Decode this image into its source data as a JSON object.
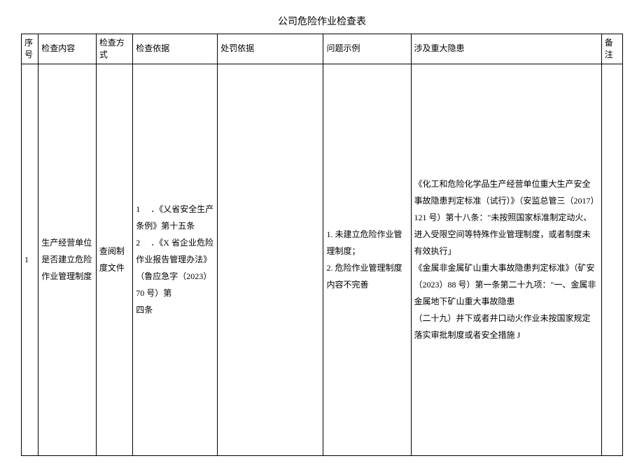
{
  "title": "公司危险作业检查表",
  "headers": {
    "seq": "序号",
    "content": "检查内容",
    "method": "检查方式",
    "basis": "检查依据",
    "penalty": "处罚依据",
    "example": "问题示例",
    "hazard": "涉及重大隐患",
    "remark": "备注"
  },
  "rows": [
    {
      "seq": "1",
      "content": "生产经营单位是否建立危险作业管理制度",
      "method": "查阅制度文件",
      "basis": "1 　．《乂省安全生产条例》第十五条\n2 　．《X 省企业危险作业报告管理办法》（鲁应急字（2023）70 号）第\n四条",
      "penalty": "",
      "example": "1. 未建立危险作业管理制度；\n2. 危险作业管理制度内容不完善",
      "hazard": "《化工和危险化学品生产经营单位重大生产安全事故隐患判定标准（试行）》（安监总管三（2017）121 号）第十八条：\"未按照国家标准制定动火、进入受限空间等特殊作业管理制度，或者制度未有效执行」\n《金属非金属矿山重大事故隐患判定标准》（矿安（2023）88 号）第一条第二十九项：\"一、金属非金属地下矿山重大事故隐患\n（二十九）井下或者井口动火作业未按国家规定落实审批制度或者安全措施 J",
      "remark": ""
    }
  ]
}
